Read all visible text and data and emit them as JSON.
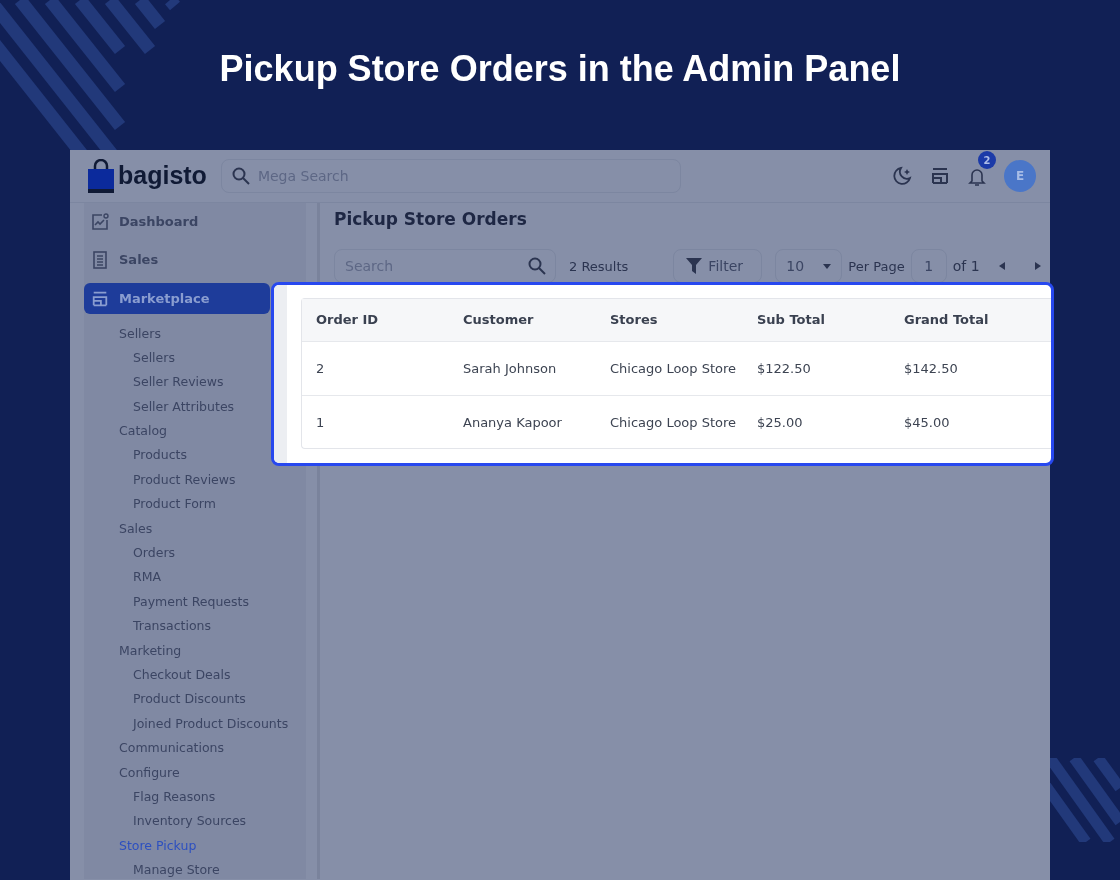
{
  "banner": {
    "title": "Pickup Store Orders in the Admin Panel"
  },
  "header": {
    "logo": "bagisto",
    "search_placeholder": "Mega Search",
    "notification_count": "2",
    "avatar": "E"
  },
  "sidebar": {
    "items": [
      {
        "label": "Dashboard",
        "selected": false
      },
      {
        "label": "Sales",
        "selected": false
      },
      {
        "label": "Marketplace",
        "selected": true,
        "children": [
          {
            "label": "Sellers",
            "selected": false,
            "children": [
              {
                "label": "Sellers",
                "selected": false
              },
              {
                "label": "Seller Reviews",
                "selected": false
              },
              {
                "label": "Seller Attributes",
                "selected": false
              }
            ]
          },
          {
            "label": "Catalog",
            "selected": false,
            "children": [
              {
                "label": "Products",
                "selected": false
              },
              {
                "label": "Product Reviews",
                "selected": false
              },
              {
                "label": "Product Form",
                "selected": false
              }
            ]
          },
          {
            "label": "Sales",
            "selected": false,
            "children": [
              {
                "label": "Orders",
                "selected": false
              },
              {
                "label": "RMA",
                "selected": false
              },
              {
                "label": "Payment Requests",
                "selected": false
              },
              {
                "label": "Transactions",
                "selected": false
              }
            ]
          },
          {
            "label": "Marketing",
            "selected": false,
            "children": [
              {
                "label": "Checkout Deals",
                "selected": false
              },
              {
                "label": "Product Discounts",
                "selected": false
              },
              {
                "label": "Joined Product Discounts",
                "selected": false
              }
            ]
          },
          {
            "label": "Communications",
            "selected": false
          },
          {
            "label": "Configure",
            "selected": false,
            "children": [
              {
                "label": "Flag Reasons",
                "selected": false
              },
              {
                "label": "Inventory Sources",
                "selected": false
              }
            ]
          },
          {
            "label": "Store Pickup",
            "selected": true,
            "children": [
              {
                "label": "Manage Store",
                "selected": false
              }
            ]
          }
        ]
      }
    ]
  },
  "page": {
    "title": "Pickup Store Orders",
    "search_placeholder": "Search",
    "results": "2 Results",
    "filter": "Filter",
    "per_page_value": "10",
    "per_page_label": "Per Page",
    "page": "1",
    "page_total": "of 1"
  },
  "table": {
    "columns": [
      "Order ID",
      "Customer",
      "Stores",
      "Sub Total",
      "Grand Total"
    ],
    "rows": [
      [
        "2",
        "Sarah Johnson",
        "Chicago Loop Store",
        "$122.50",
        "$142.50"
      ],
      [
        "1",
        "Ananya Kapoor",
        "Chicago Loop Store",
        "$25.00",
        "$45.00"
      ]
    ]
  }
}
